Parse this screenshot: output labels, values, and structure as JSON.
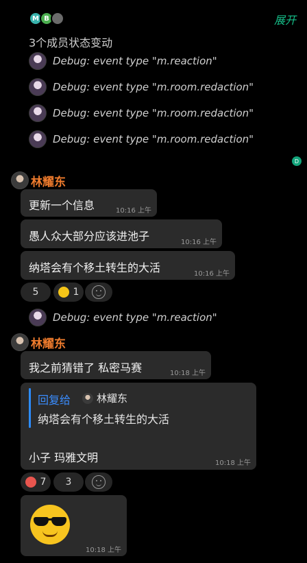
{
  "header": {
    "member_avatars": [
      "M",
      "B",
      ""
    ],
    "expand_label": "展开",
    "members_change": "3个成员状态变动"
  },
  "debug_events": [
    "Debug:  event type \"m.reaction\"",
    "Debug:  event type \"m.room.redaction\"",
    "Debug:  event type \"m.room.redaction\"",
    "Debug:  event type \"m.room.redaction\""
  ],
  "read_receipt": "D",
  "group1": {
    "sender": "林耀东",
    "messages": [
      {
        "text": "更新一个信息",
        "time": "10:16 上午"
      },
      {
        "text": "愚人众大部分应该进池子",
        "time": "10:16 上午"
      },
      {
        "text": "纳塔会有个移土转生的大活",
        "time": "10:16 上午"
      }
    ],
    "reactions": [
      {
        "count": "5"
      },
      {
        "count": "1"
      }
    ]
  },
  "debug_event_2": "Debug:  event type \"m.reaction\"",
  "group2": {
    "sender": "林耀东",
    "message": {
      "text": "我之前猜错了 私密马赛",
      "time": "10:18 上午"
    },
    "reply": {
      "link": "回复给",
      "to_name": "林耀东",
      "quoted": "纳塔会有个移土转生的大活",
      "text": "小子 玛雅文明",
      "time": "10:18 上午"
    },
    "reactions": [
      {
        "count": "7"
      },
      {
        "count": "3"
      }
    ],
    "sticker_time": "10:18 上午"
  },
  "colors": {
    "accent": "#16c08a",
    "sender_name": "#ee7b2d",
    "reply_link": "#3a8dff",
    "bubble": "#2b2b2b"
  }
}
